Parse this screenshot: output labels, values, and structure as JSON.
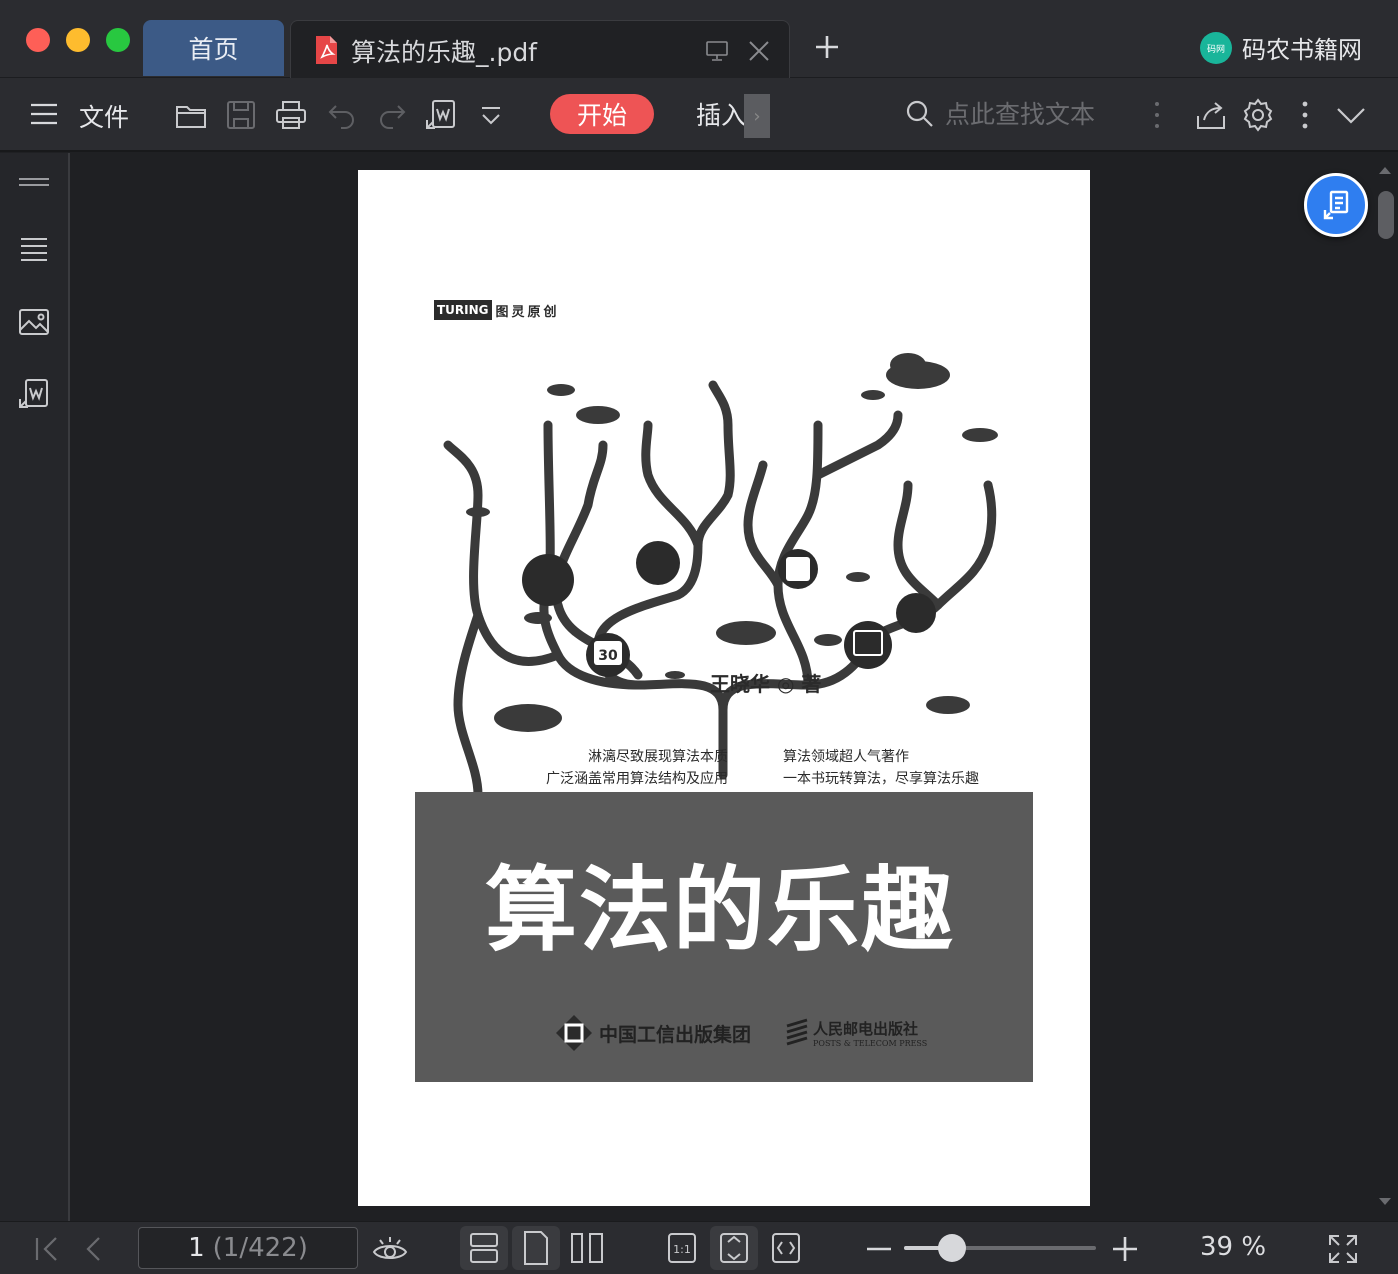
{
  "window": {
    "traffic_lights": {
      "close": "#fe5f57",
      "minimize": "#febc2e",
      "zoom": "#28c840"
    }
  },
  "tabs": [
    {
      "label": "首页",
      "active": false
    },
    {
      "label": "算法的乐趣_.pdf",
      "active": true,
      "icon": "pdf-icon"
    }
  ],
  "brand": {
    "label": "码农书籍网"
  },
  "toolbar": {
    "menu_label": "文件",
    "start_label": "开始",
    "insert_label": "插入",
    "search_placeholder": "点此查找文本"
  },
  "document": {
    "publisher_logo": "TURING",
    "series": "图灵原创",
    "author": "王晓华 ◎ 著",
    "tagline_left": [
      "淋漓尽致展现算法本质",
      "广泛涵盖常用算法结构及应用"
    ],
    "tagline_right": [
      "算法领域超人气著作",
      "一本书玩转算法，尽享算法乐趣"
    ],
    "title": "算法的乐趣",
    "publisher_1": "中国工信出版集团",
    "publisher_2_cn": "人民邮电出版社",
    "publisher_2_en": "POSTS & TELECOM PRESS",
    "badge_number": "30"
  },
  "footer": {
    "page_number": "1",
    "page_count": "(1/422)",
    "zoom_percent": "39 %",
    "zoom_fraction": 0.25
  },
  "colors": {
    "accent_red": "#ee5455",
    "accent_blue": "#2f7ef0",
    "tab_active_bg": "#3c5a86"
  }
}
